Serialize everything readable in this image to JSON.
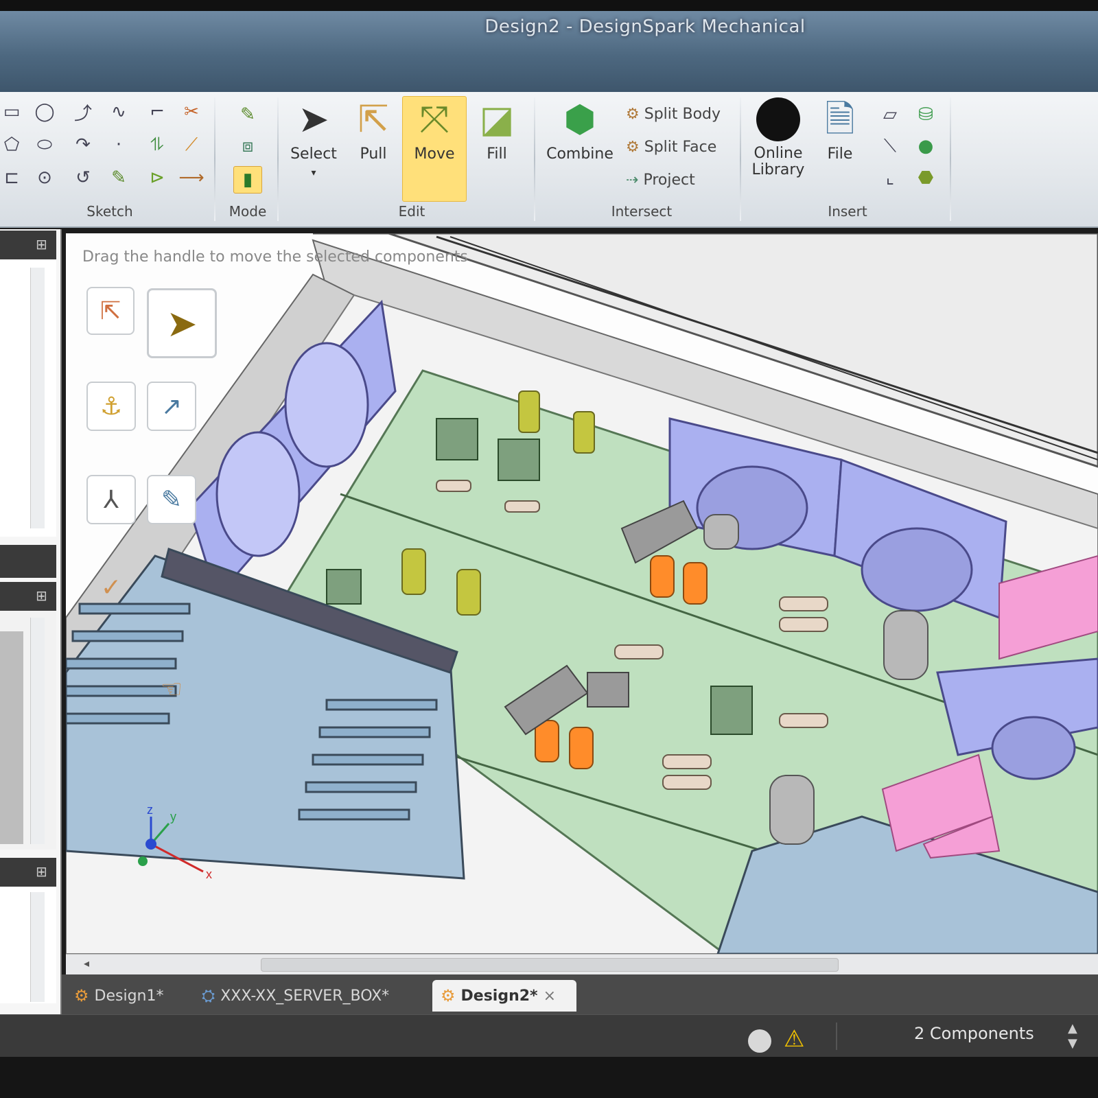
{
  "window": {
    "title": "Design2 - DesignSpark Mechanical"
  },
  "ribbon": {
    "groups": [
      {
        "label": "Sketch"
      },
      {
        "label": "Mode"
      },
      {
        "label": "Edit"
      },
      {
        "label": "Intersect"
      },
      {
        "label": "Insert"
      }
    ],
    "edit": {
      "select_label": "Select",
      "pull_label": "Pull",
      "move_label": "Move",
      "fill_label": "Fill"
    },
    "intersect": {
      "combine_label": "Combine",
      "split_body_label": "Split Body",
      "split_face_label": "Split Face",
      "project_label": "Project"
    },
    "insert": {
      "online_library_label": "Online\nLibrary",
      "file_label": "File"
    }
  },
  "viewport": {
    "hint": "Drag the handle to move the selected components",
    "axis": {
      "x": "x",
      "y": "y",
      "z": "z"
    }
  },
  "tabs": [
    {
      "label": "Design1*",
      "icon": "design-icon",
      "active": false
    },
    {
      "label": "XXX-XX_SERVER_BOX*",
      "icon": "assembly-icon",
      "active": false
    },
    {
      "label": "Design2*",
      "icon": "design-icon",
      "active": true
    }
  ],
  "tab_close": "×",
  "status": {
    "components": "2 Components"
  },
  "colors": {
    "ribbon_highlight": "#ffe07a",
    "pcb_green": "#bfe0bf",
    "fan_purple": "#aab0f0",
    "heatsink_blue": "#a8c2d8",
    "capacitor_orange": "#ff8c2a",
    "pink_part": "#f59fd6"
  }
}
